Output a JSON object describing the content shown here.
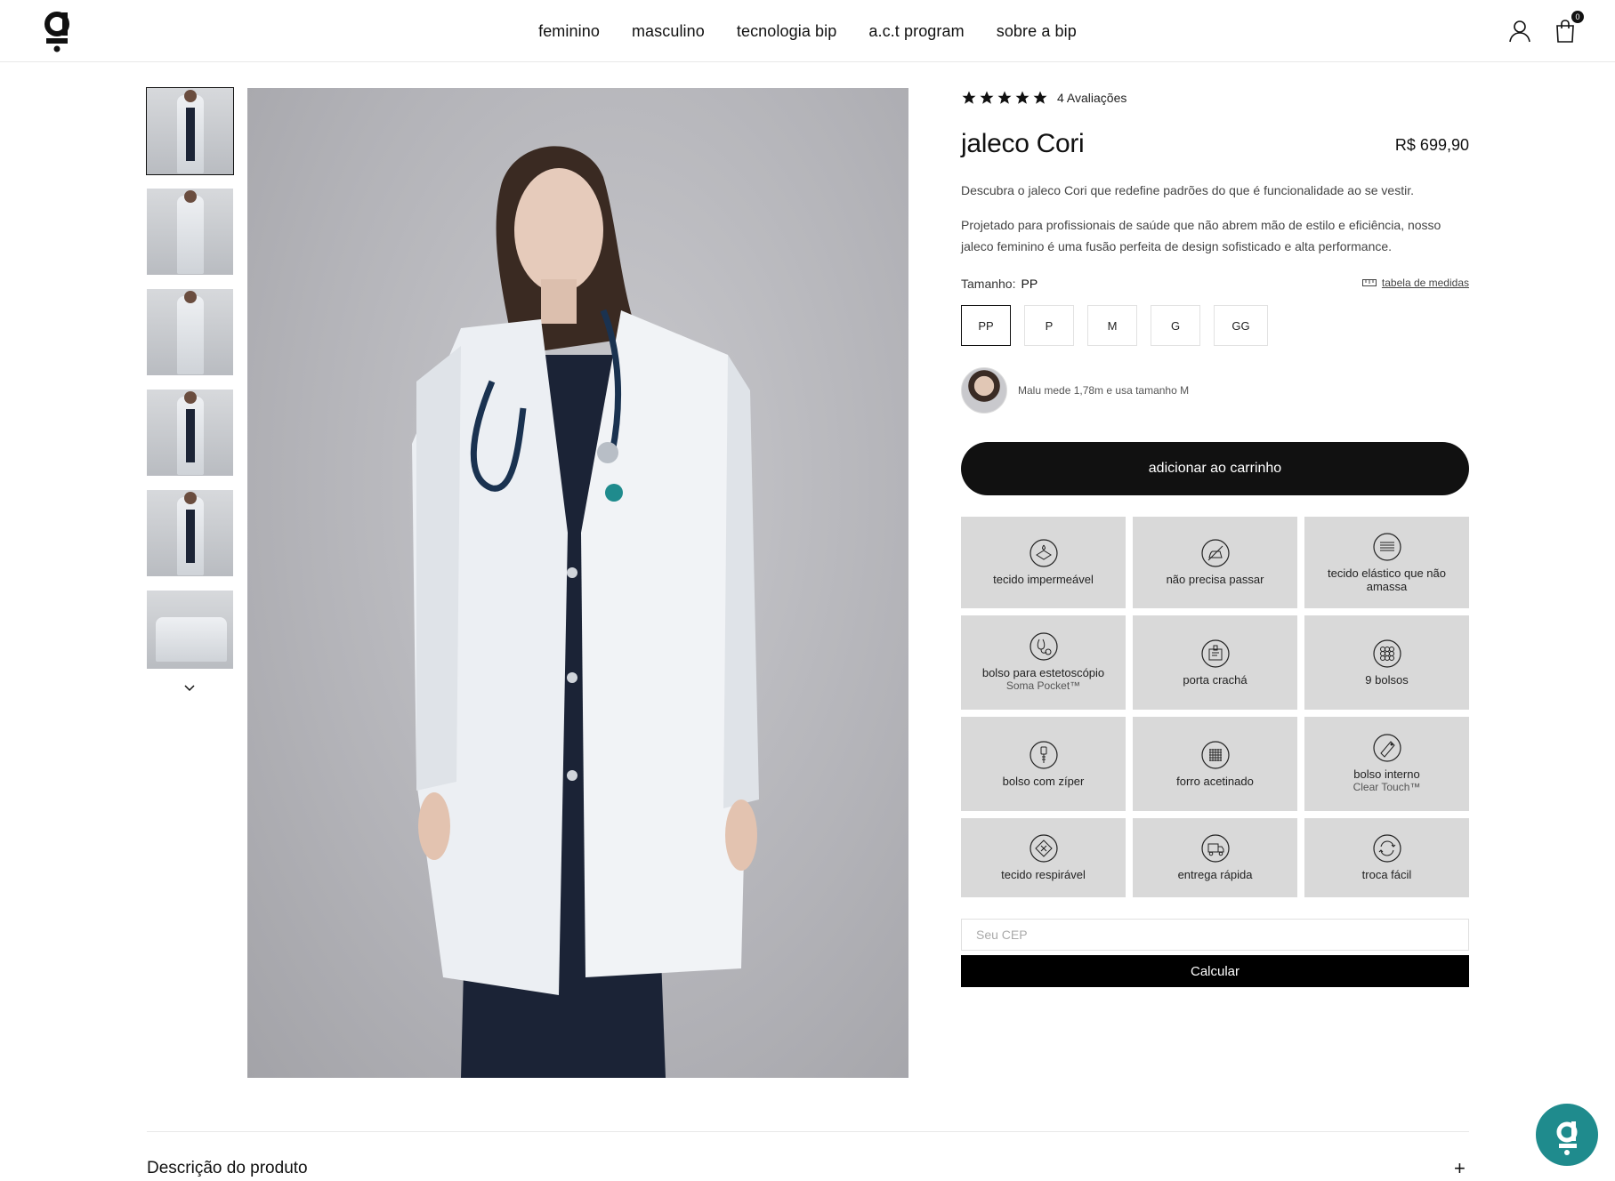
{
  "header": {
    "logo_text": "bip",
    "nav": [
      "feminino",
      "masculino",
      "tecnologia bip",
      "a.c.t program",
      "sobre a bip"
    ],
    "cart_count": "0"
  },
  "gallery": {
    "thumbnail_count": 6,
    "active_index": 0
  },
  "product": {
    "rating": 5,
    "reviews_label": "4 Avaliações",
    "title": "jaleco Cori",
    "price": "R$ 699,90",
    "description_1": "Descubra o jaleco Cori que redefine padrões do que é funcionalidade ao se vestir.",
    "description_2": "Projetado para profissionais de saúde que não abrem mão de estilo e eficiência, nosso jaleco feminino é uma fusão perfeita de design sofisticado e alta performance.",
    "size_label": "Tamanho:",
    "selected_size": "PP",
    "size_table_link": "tabela de medidas",
    "sizes": [
      "PP",
      "P",
      "M",
      "G",
      "GG"
    ],
    "model_info": "Malu mede 1,78m e usa tamanho M",
    "add_to_cart": "adicionar ao carrinho"
  },
  "features": [
    {
      "label": "tecido impermeável",
      "sub": "",
      "icon": "waterproof-icon"
    },
    {
      "label": "não precisa passar",
      "sub": "",
      "icon": "no-iron-icon"
    },
    {
      "label": "tecido elástico que não amassa",
      "sub": "",
      "icon": "stretch-fabric-icon"
    },
    {
      "label": "bolso para estetoscópio",
      "sub": "Soma Pocket™",
      "icon": "stethoscope-icon"
    },
    {
      "label": "porta crachá",
      "sub": "",
      "icon": "badge-icon"
    },
    {
      "label": "9 bolsos",
      "sub": "",
      "icon": "pockets-icon"
    },
    {
      "label": "bolso com zíper",
      "sub": "",
      "icon": "zipper-icon"
    },
    {
      "label": "forro acetinado",
      "sub": "",
      "icon": "satin-lining-icon"
    },
    {
      "label": "bolso interno",
      "sub": "Clear Touch™",
      "icon": "inner-pocket-icon"
    },
    {
      "label": "tecido respirável",
      "sub": "",
      "icon": "breathable-icon"
    },
    {
      "label": "entrega rápida",
      "sub": "",
      "icon": "fast-delivery-icon"
    },
    {
      "label": "troca fácil",
      "sub": "",
      "icon": "easy-exchange-icon"
    }
  ],
  "shipping": {
    "cep_placeholder": "Seu CEP",
    "calculate": "Calcular"
  },
  "accordion": {
    "title": "Descrição do produto"
  },
  "colors": {
    "accent": "#1f8b8d",
    "button": "#111111",
    "feature_bg": "#d9d9d9"
  }
}
